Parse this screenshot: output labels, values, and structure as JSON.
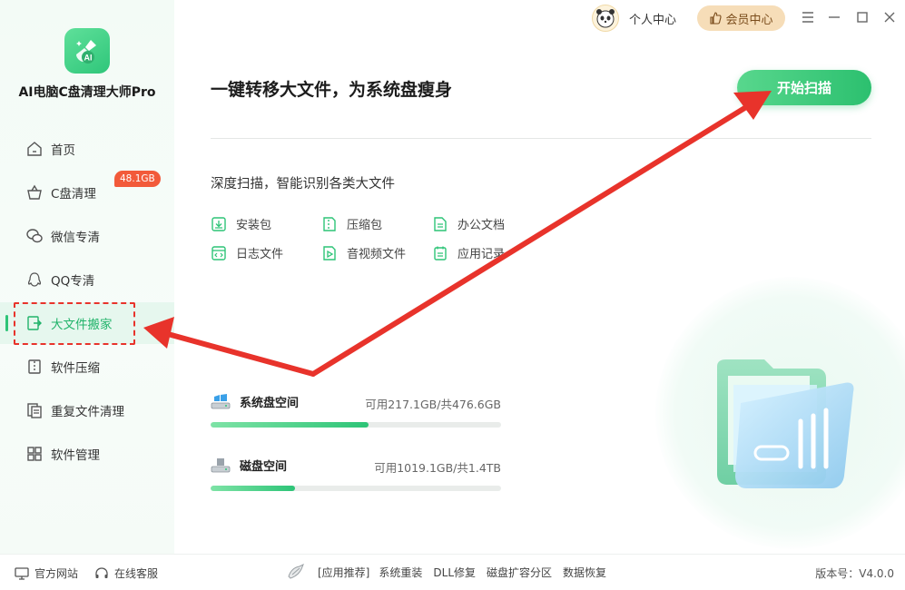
{
  "app": {
    "title": "AI电脑C盘清理大师Pro",
    "accent": "#2dc477",
    "alert": "#e8332b"
  },
  "sidebar": {
    "items": [
      {
        "label": "首页",
        "icon": "home-icon"
      },
      {
        "label": "C盘清理",
        "icon": "basket-icon",
        "badge": "48.1GB"
      },
      {
        "label": "微信专清",
        "icon": "wechat-icon"
      },
      {
        "label": "QQ专清",
        "icon": "qq-icon"
      },
      {
        "label": "大文件搬家",
        "icon": "file-move-icon",
        "active": true
      },
      {
        "label": "软件压缩",
        "icon": "zip-icon"
      },
      {
        "label": "重复文件清理",
        "icon": "duplicate-icon"
      },
      {
        "label": "软件管理",
        "icon": "apps-icon"
      }
    ]
  },
  "topbar": {
    "personal_label": "个人中心",
    "vip_label": "会员中心"
  },
  "main": {
    "headline": "一键转移大文件，为系统盘瘦身",
    "scan_button": "开始扫描",
    "subtitle": "深度扫描，智能识别各类大文件",
    "file_types": [
      {
        "label": "安装包",
        "icon": "install-icon"
      },
      {
        "label": "压缩包",
        "icon": "archive-icon"
      },
      {
        "label": "办公文档",
        "icon": "document-icon"
      },
      {
        "label": "日志文件",
        "icon": "log-icon"
      },
      {
        "label": "音视频文件",
        "icon": "media-icon"
      },
      {
        "label": "应用记录",
        "icon": "record-icon"
      }
    ],
    "disks": [
      {
        "label": "系统盘空间",
        "info": "可用217.1GB/共476.6GB",
        "used_fraction": 0.545
      },
      {
        "label": "磁盘空间",
        "info": "可用1019.1GB/共1.4TB",
        "used_fraction": 0.29
      }
    ]
  },
  "bottombar": {
    "website": "官方网站",
    "service": "在线客服",
    "rec_label": "[应用推荐]",
    "links": [
      "系统重装",
      "DLL修复",
      "磁盘扩容分区",
      "数据恢复"
    ],
    "version": "版本号：V4.0.0"
  }
}
